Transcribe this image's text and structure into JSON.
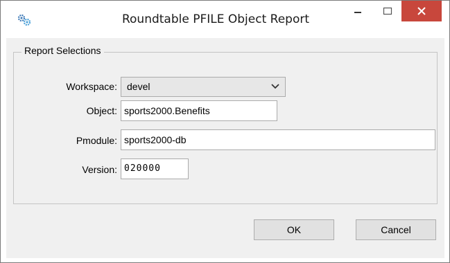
{
  "window": {
    "title": "Roundtable PFILE Object Report",
    "close_color": "#c8473c"
  },
  "icons": {
    "app": "app-gears-icon",
    "minimize": "minimize-icon",
    "maximize": "maximize-icon",
    "close": "close-icon",
    "dropdown": "chevron-down-icon"
  },
  "group": {
    "legend": "Report Selections"
  },
  "fields": {
    "workspace": {
      "label": "Workspace:",
      "value": "devel"
    },
    "object": {
      "label": "Object:",
      "value": "sports2000.Benefits"
    },
    "pmodule": {
      "label": "Pmodule:",
      "value": "sports2000-db"
    },
    "version": {
      "label": "Version:",
      "value": "020000"
    }
  },
  "buttons": {
    "ok": "OK",
    "cancel": "Cancel"
  }
}
